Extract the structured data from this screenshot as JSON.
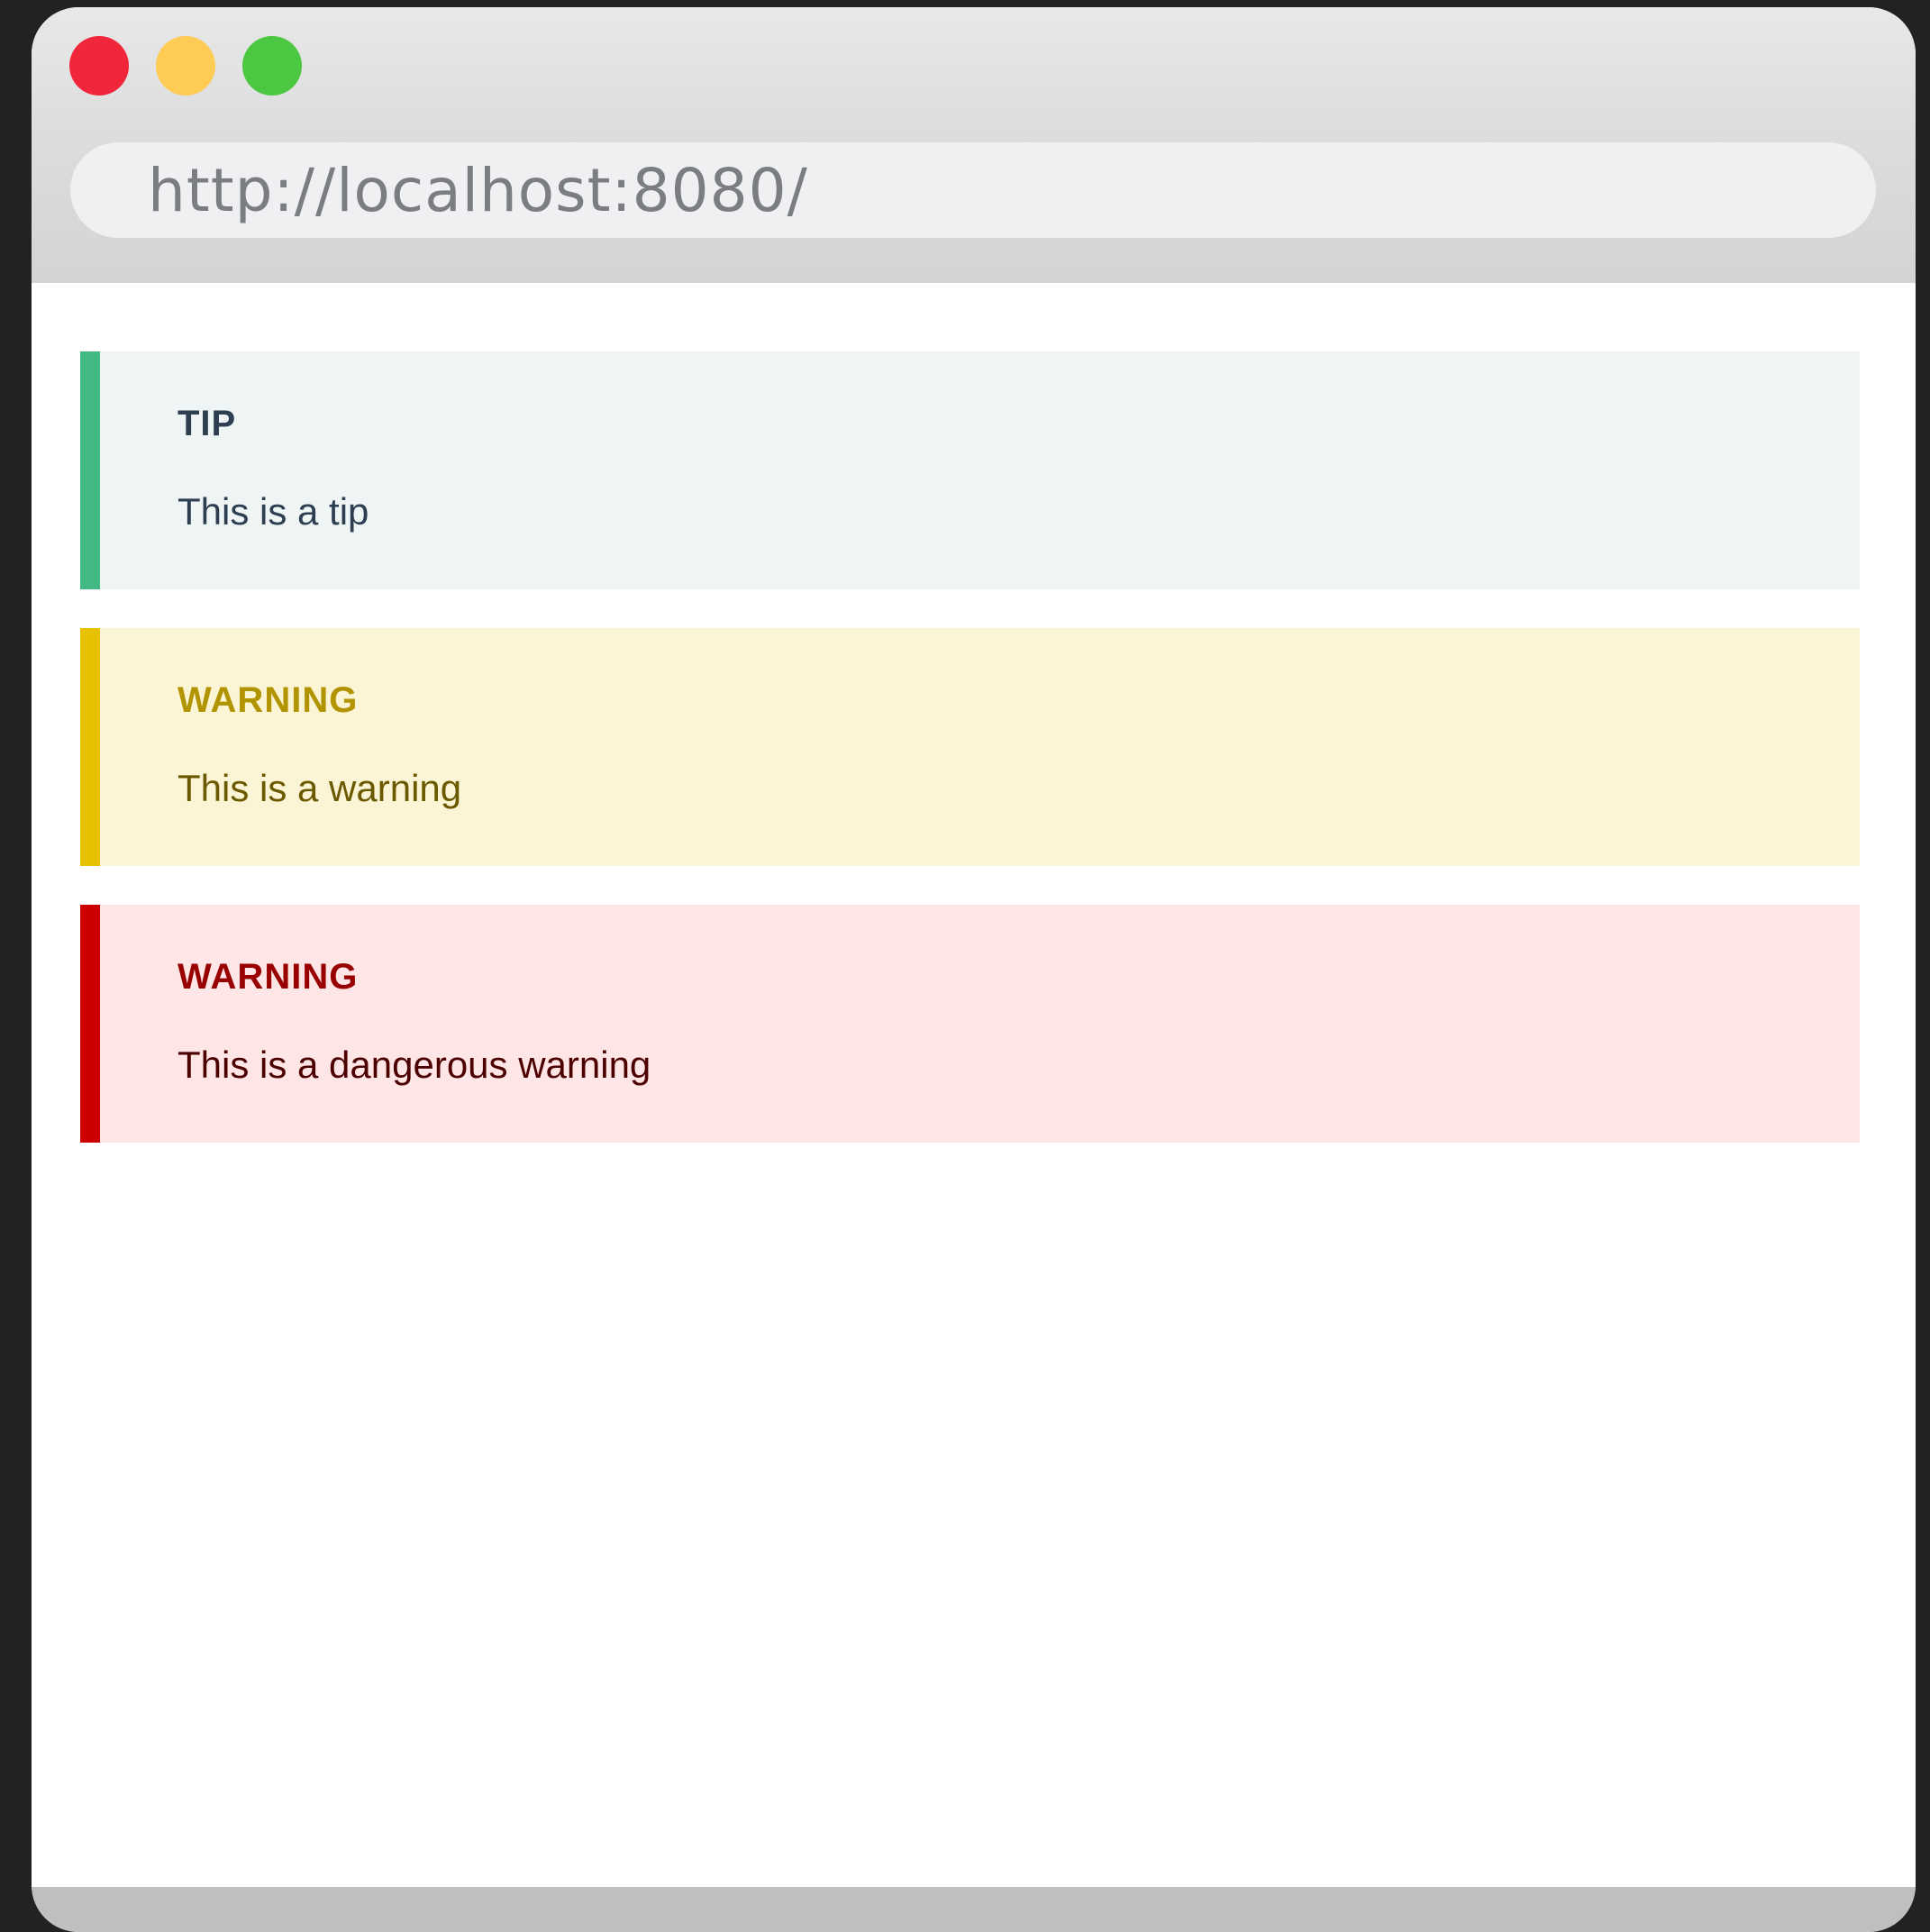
{
  "browser": {
    "url": "http://localhost:8080/",
    "controls": {
      "close_color": "#f2263b",
      "minimize_color": "#fecb54",
      "zoom_color": "#4cc741"
    }
  },
  "callouts": [
    {
      "type": "tip",
      "title": "TIP",
      "text": "This is a tip",
      "accent": "#42b883",
      "background": "#eff4f5"
    },
    {
      "type": "warning",
      "title": "WARNING",
      "text": "This is a warning",
      "accent": "#e7c000",
      "background": "#fbf5d5"
    },
    {
      "type": "danger",
      "title": "WARNING",
      "text": "This is a dangerous warning",
      "accent": "#cc0000",
      "background": "#fee6e6"
    }
  ]
}
